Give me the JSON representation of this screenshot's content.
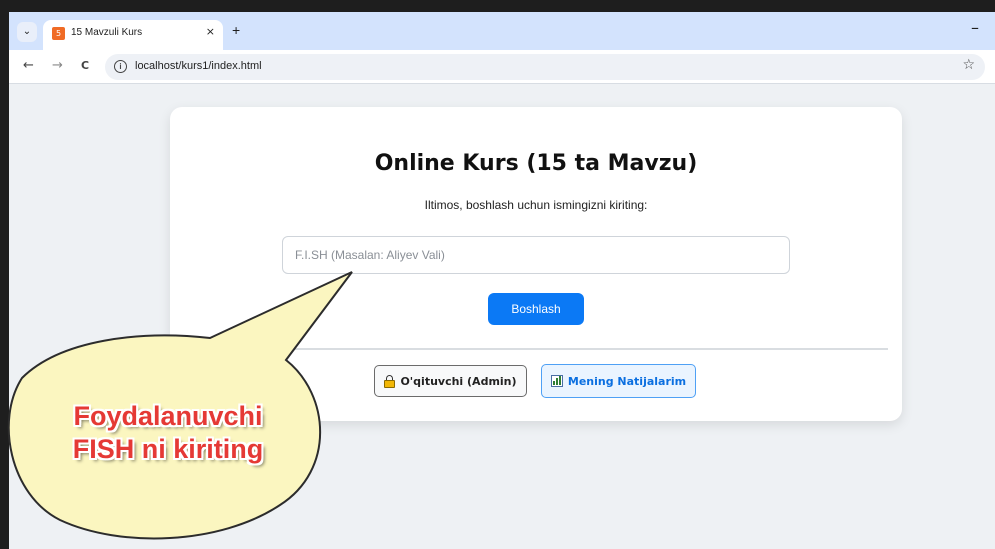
{
  "browser": {
    "tab_title": "15 Mavzuli Kurs",
    "tab_favicon": "html",
    "tab_close": "×",
    "new_tab": "+",
    "minimize": "–",
    "back_icon": "←",
    "forward_icon": "→",
    "reload_icon": "C",
    "tab_search_icon": "⌄",
    "url": "localhost/kurs1/index.html",
    "bookmark_icon": "☆"
  },
  "card": {
    "title": "Online Kurs (15 ta Mavzu)",
    "subtitle": "Iltimos, boshlash uchun ismingizni kiriting:",
    "name_input": {
      "placeholder": "F.I.SH (Masalan: Aliyev Vali)",
      "value": ""
    },
    "start_button": "Boshlash",
    "admin_button": "O'qituvchi (Admin)",
    "admin_icon": "lock-icon",
    "results_button": "Mening Natijalarim",
    "results_icon": "bar-chart-icon",
    "accent_color": "#0b79f5"
  },
  "callout": {
    "line1": "Foydalanuvchi",
    "line2": "FISH ni kiriting",
    "text_color": "#e53935",
    "fill_color": "#fbf6c0"
  }
}
